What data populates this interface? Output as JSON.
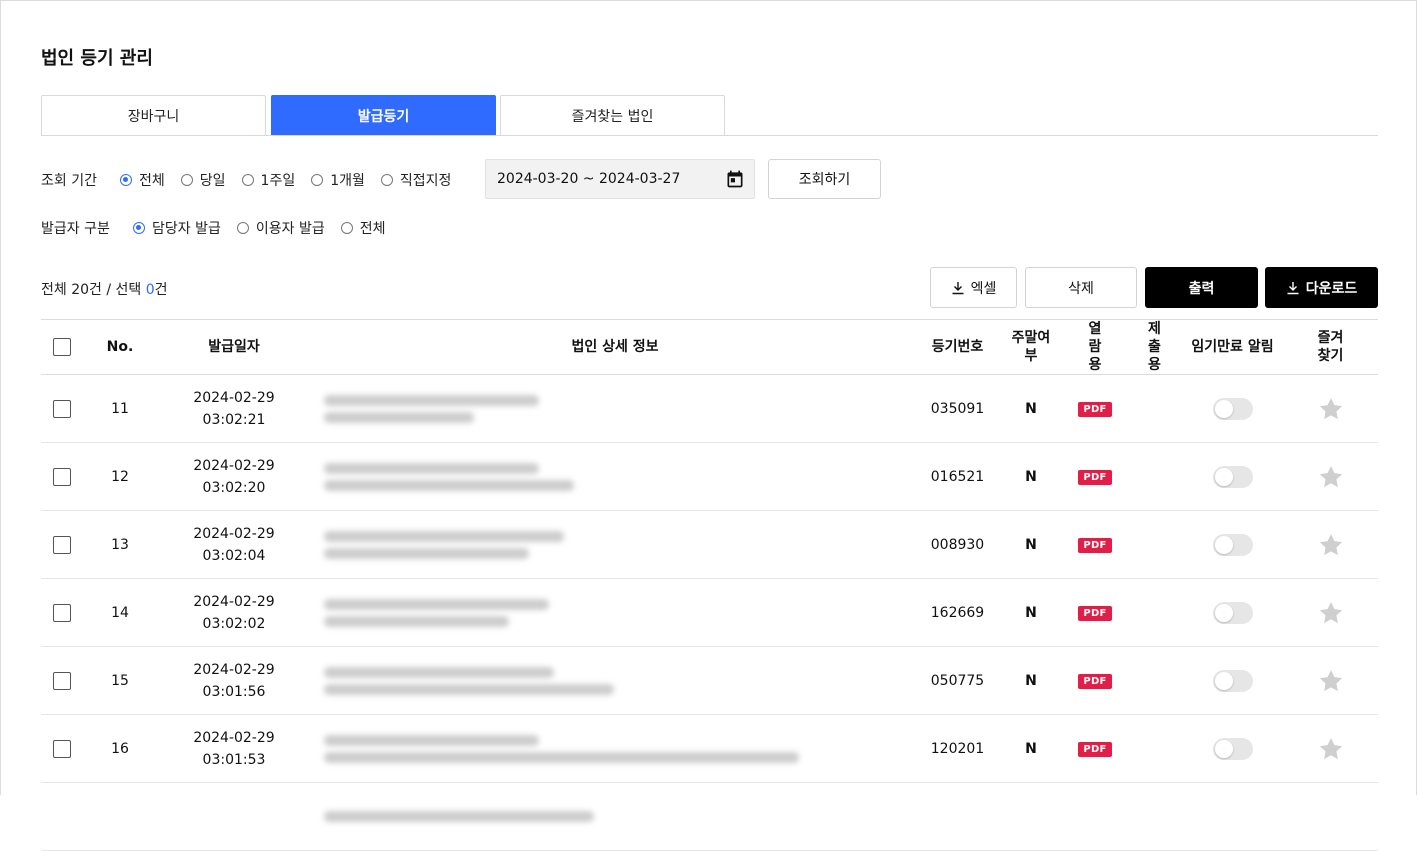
{
  "page": {
    "title": "법인 등기 관리"
  },
  "tabs": [
    {
      "label": "장바구니",
      "active": false
    },
    {
      "label": "발급등기",
      "active": true
    },
    {
      "label": "즐겨찾는 법인",
      "active": false
    }
  ],
  "filters": {
    "period": {
      "label": "조회 기간",
      "options": [
        "전체",
        "당일",
        "1주일",
        "1개월",
        "직접지정"
      ],
      "selected": "전체",
      "date_range": "2024-03-20 ~ 2024-03-27",
      "search_button": "조회하기"
    },
    "issuer": {
      "label": "발급자 구분",
      "options": [
        "담당자 발급",
        "이용자 발급",
        "전체"
      ],
      "selected": "담당자 발급"
    }
  },
  "summary": {
    "prefix": "전체 20건 / 선택 ",
    "selected_count": "0",
    "suffix": "건"
  },
  "actions": {
    "excel": "엑셀",
    "delete": "삭제",
    "print": "출력",
    "download": "다운로드"
  },
  "table": {
    "headers": {
      "no": "No.",
      "date": "발급일자",
      "detail": "법인 상세 정보",
      "reg_no": "등기번호",
      "weekend": "주말여부",
      "view": "열람용",
      "submit": "제출용",
      "expiry": "임기만료 알림",
      "favorite": "즐겨찾기"
    },
    "rows": [
      {
        "no": "11",
        "date": "2024-02-29",
        "time": "03:02:21",
        "reg_no": "035091",
        "weekend": "N",
        "view": "PDF"
      },
      {
        "no": "12",
        "date": "2024-02-29",
        "time": "03:02:20",
        "reg_no": "016521",
        "weekend": "N",
        "view": "PDF"
      },
      {
        "no": "13",
        "date": "2024-02-29",
        "time": "03:02:04",
        "reg_no": "008930",
        "weekend": "N",
        "view": "PDF"
      },
      {
        "no": "14",
        "date": "2024-02-29",
        "time": "03:02:02",
        "reg_no": "162669",
        "weekend": "N",
        "view": "PDF"
      },
      {
        "no": "15",
        "date": "2024-02-29",
        "time": "03:01:56",
        "reg_no": "050775",
        "weekend": "N",
        "view": "PDF"
      },
      {
        "no": "16",
        "date": "2024-02-29",
        "time": "03:01:53",
        "reg_no": "120201",
        "weekend": "N",
        "view": "PDF"
      }
    ]
  },
  "colors": {
    "accent": "#2f6bff",
    "pdf": "#e11d48",
    "dark_button": "#000000"
  },
  "icons": [
    "calendar-icon",
    "download-icon",
    "star-icon",
    "pdf-icon"
  ]
}
